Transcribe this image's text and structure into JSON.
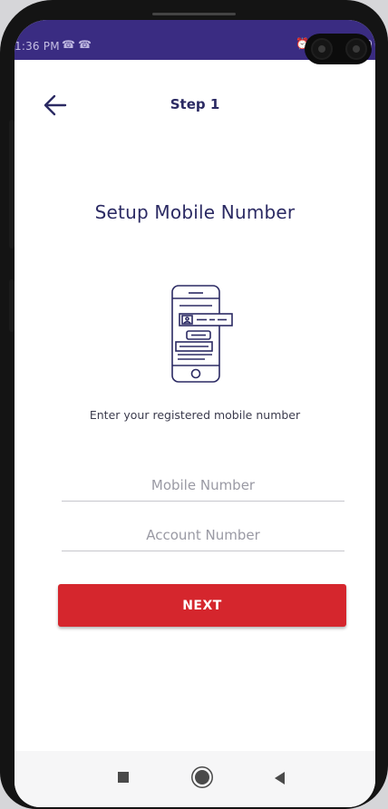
{
  "status_bar": {
    "time": "1:36 PM",
    "notification_icons": [
      "missed-call-icon",
      "missed-call-icon"
    ],
    "right_icons": [
      "alarm-icon",
      "battery-icon"
    ]
  },
  "header": {
    "title": "Step 1",
    "back_icon": "arrow-left-icon"
  },
  "main": {
    "title": "Setup Mobile Number",
    "illustration_icon": "phone-id-card-icon",
    "instruction": "Enter your registered mobile number",
    "mobile_field": {
      "placeholder": "Mobile Number",
      "value": ""
    },
    "account_field": {
      "placeholder": "Account Number",
      "value": ""
    },
    "next_label": "NEXT"
  },
  "nav_bar": {
    "buttons": [
      "recents-icon",
      "home-icon",
      "back-icon"
    ]
  },
  "colors": {
    "status_bar": "#3a2c82",
    "title_text": "#2b2a63",
    "primary_button": "#d5262d"
  }
}
